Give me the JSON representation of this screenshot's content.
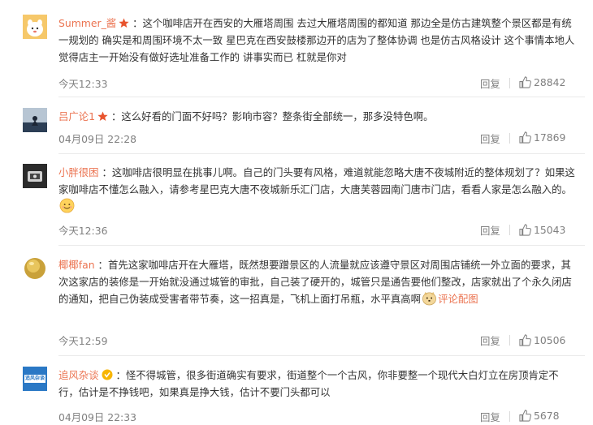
{
  "comments": [
    {
      "username": "Summer_酱",
      "text": "这个咖啡店开在西安的大雁塔周围 去过大雁塔周围的都知道 那边全是仿古建筑整个景区都是有统一规划的 确实是和周围环境不太一致 星巴克在西安鼓楼那边开的店为了整体协调 也是仿古风格设计 这个事情本地人觉得店主一开始没有做好选址准备工作的 讲事实而已 杠就是你对",
      "time": "今天12:33",
      "reply": "回复",
      "likes": "28842"
    },
    {
      "username": "吕广论1",
      "text": "这么好看的门面不好吗？影响市容？整条街全部统一，那多没特色啊。",
      "time": "04月09日 22:28",
      "reply": "回复",
      "likes": "17869"
    },
    {
      "username": "小胖很困",
      "text": "这咖啡店很明显在挑事儿啊。自己的门头要有风格，难道就能忽略大唐不夜城附近的整体规划了？如果这家咖啡店不懂怎么融入，请参考星巴克大唐不夜城新乐汇门店，大唐芙蓉园南门唐市门店，看看人家是怎么融入的。",
      "time": "今天12:36",
      "reply": "回复",
      "likes": "15043"
    },
    {
      "username": "椰椰fan",
      "text": "首先这家咖啡店开在大雁塔，既然想要蹭景区的人流量就应该遵守景区对周围店铺统一外立面的要求，其次这家店的装修是一开始就没通过城管的审批，自己装了硬开的，城管只是通告要他们整改，店家就出了个永久闭店的通知，把自己伪装成受害者带节奏，这一招真是，飞机上面打吊瓶，水平真高啊",
      "link": "评论配图",
      "time": "今天12:59",
      "reply": "回复",
      "likes": "10506"
    },
    {
      "username": "追风杂谈",
      "avatar_text": "追风杂谈",
      "text": "怪不得城管，很多街道确实有要求，街道整个一个古风，你非要整一个现代大白灯立在房顶肯定不行，估计是不挣钱吧，如果真是挣大钱，估计不要门头都可以",
      "time": "04月09日 22:33",
      "reply": "回复",
      "likes": "5678"
    }
  ],
  "colors": {
    "username": "#eb7350",
    "meta": "#808080",
    "text": "#333333"
  }
}
